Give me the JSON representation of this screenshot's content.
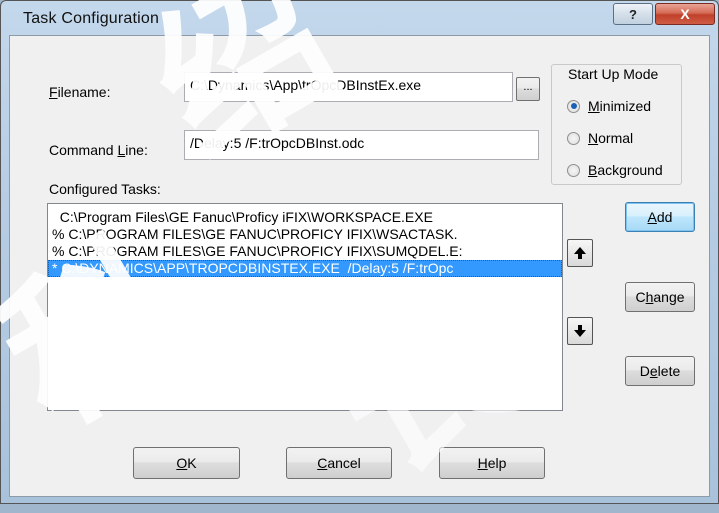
{
  "window": {
    "title": "Task Configuration",
    "help_glyph": "?",
    "close_glyph": "X"
  },
  "filename": {
    "label_prefix": "",
    "label_accel": "F",
    "label_rest": "ilename:",
    "value": "C:\\Dynamics\\App\\trOpcDBInstEx.exe",
    "browse_label": "..."
  },
  "command_line": {
    "label_prefix": "Command ",
    "label_accel": "L",
    "label_rest": "ine:",
    "value": "/Delay:5 /F:trOpcDBInst.odc"
  },
  "configured_tasks": {
    "label": "Configured Tasks:",
    "items": [
      {
        "text": "  C:\\Program Files\\GE Fanuc\\Proficy iFIX\\WORKSPACE.EXE",
        "selected": false
      },
      {
        "text": "% C:\\PROGRAM FILES\\GE FANUC\\PROFICY IFIX\\WSACTASK.",
        "selected": false
      },
      {
        "text": "% C:\\PROGRAM FILES\\GE FANUC\\PROFICY IFIX\\SUMQDEL.E:",
        "selected": false
      },
      {
        "text": "* C:\\DYNAMICS\\APP\\TROPCDBINSTEX.EXE  /Delay:5 /F:trOpc",
        "selected": true
      }
    ]
  },
  "start_up_mode": {
    "title": "Start Up Mode",
    "options": [
      {
        "accel": "M",
        "rest": "inimized",
        "checked": true
      },
      {
        "accel": "N",
        "rest": "ormal",
        "checked": false
      },
      {
        "accel": "B",
        "rest": "ackground",
        "checked": false
      }
    ]
  },
  "side_buttons": {
    "add": {
      "accel": "A",
      "rest": "dd"
    },
    "change": {
      "prefix": "C",
      "accel": "h",
      "rest": "ange"
    },
    "delete": {
      "prefix": "D",
      "accel": "e",
      "rest": "lete"
    }
  },
  "bottom_buttons": {
    "ok": {
      "accel": "O",
      "rest": "K"
    },
    "cancel": {
      "accel": "C",
      "rest": "ancel"
    },
    "help": {
      "accel": "H",
      "rest": "elp"
    }
  },
  "watermark": {
    "chars": [
      "绍",
      "科",
      "长"
    ]
  },
  "colors": {
    "selection": "#3399ff",
    "close_button": "#c0402a",
    "default_button_border": "#3c7fb1"
  }
}
